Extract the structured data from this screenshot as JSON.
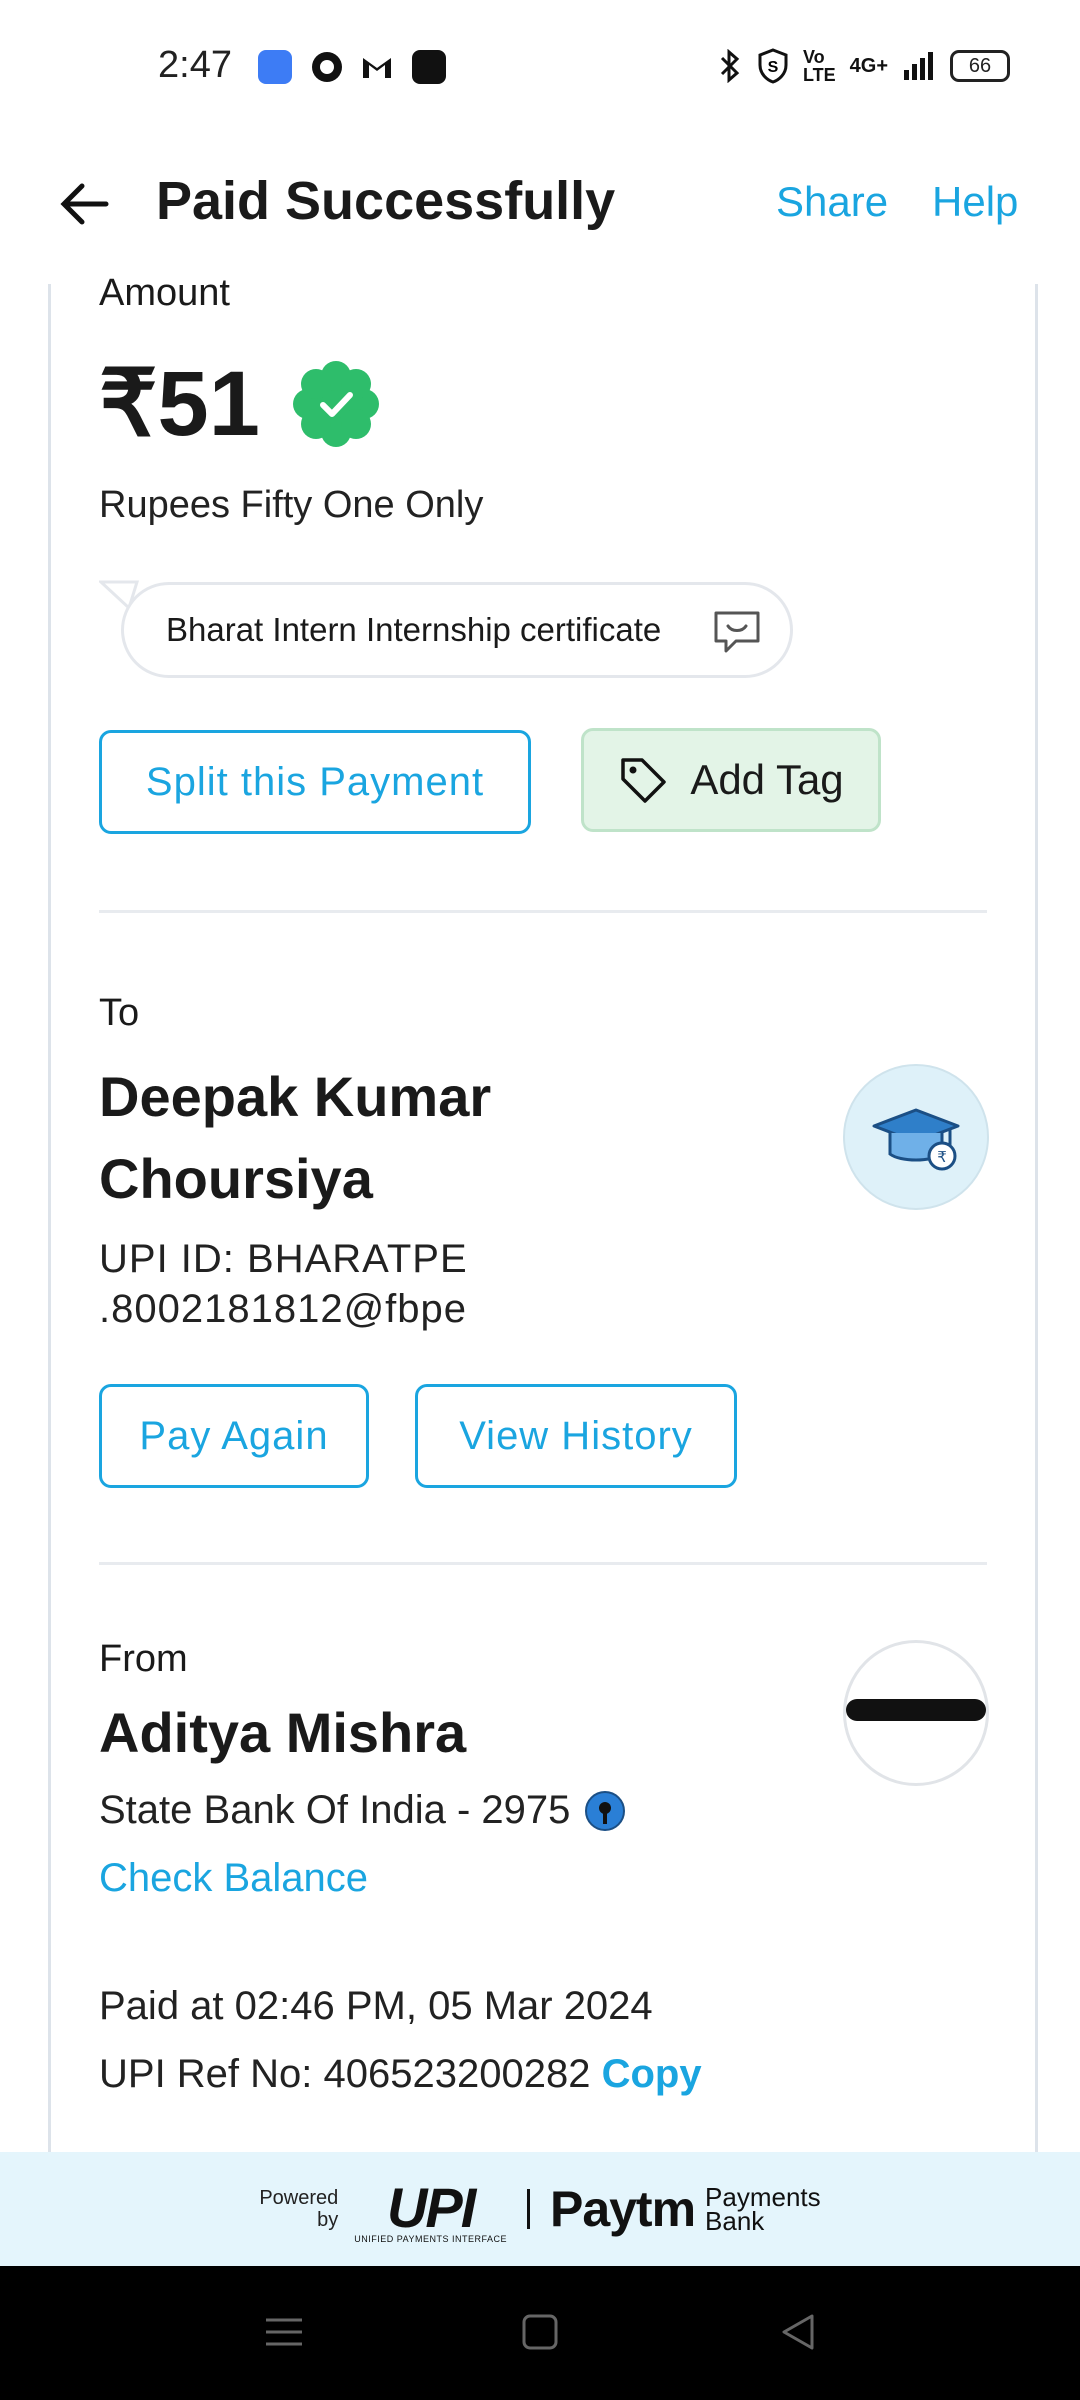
{
  "status_bar": {
    "time": "2:47",
    "signal": "4G+",
    "battery": "66",
    "icons": [
      "app-icon",
      "chat-icon",
      "gmail-icon",
      "paytm-icon",
      "bluetooth-icon",
      "shield-icon",
      "volte-icon",
      "signal-icon",
      "battery-icon"
    ]
  },
  "header": {
    "title": "Paid Successfully",
    "share_label": "Share",
    "help_label": "Help"
  },
  "payment": {
    "amount_label": "Amount",
    "amount": "₹51",
    "amount_words": "Rupees Fifty One Only",
    "note": "Bharat Intern Internship certificate",
    "split_label": "Split this Payment",
    "add_tag_label": "Add Tag"
  },
  "to": {
    "label": "To",
    "name_line1": "Deepak Kumar",
    "name_line2": "Choursiya",
    "upi_line1": "UPI ID: BHARATPE",
    "upi_line2": ".8002181812@fbpe",
    "pay_again_label": "Pay Again",
    "history_label": "View History"
  },
  "from": {
    "label": "From",
    "name": "Aditya Mishra",
    "bank": "State Bank Of India - 2975",
    "check_balance_label": "Check Balance"
  },
  "details": {
    "paid_at": "Paid at 02:46 PM, 05 Mar 2024",
    "ref_label": "UPI Ref No: 406523200282",
    "copy_label": "Copy"
  },
  "footer": {
    "powered_line1": "Powered",
    "powered_line2": "by",
    "upi_logo": "UPI",
    "upi_tagline": "UNIFIED PAYMENTS INTERFACE",
    "paytm_logo": "Paytm",
    "paytm_sub_line1": "Payments",
    "paytm_sub_line2": "Bank"
  },
  "colors": {
    "accent": "#1aa5e0",
    "success": "#2ebd6b",
    "tag_bg": "#e3f4e7",
    "footer_bg": "#e4f5fc"
  }
}
